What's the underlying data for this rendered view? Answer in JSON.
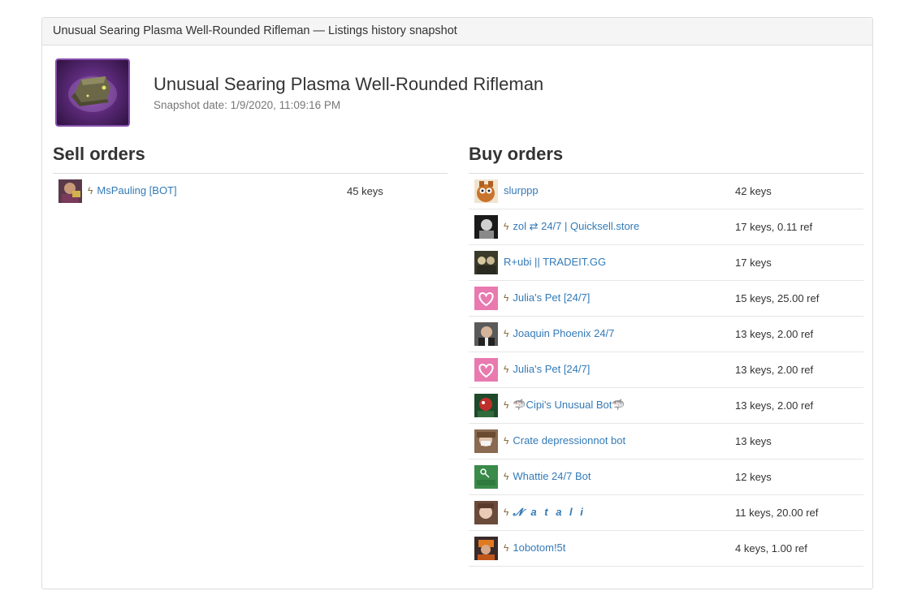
{
  "panel": {
    "heading": "Unusual Searing Plasma Well-Rounded Rifleman — Listings history snapshot"
  },
  "item": {
    "name": "Unusual Searing Plasma Well-Rounded Rifleman",
    "snapshot_date": "Snapshot date: 1/9/2020, 11:09:16 PM",
    "icon": "item-hat-icon",
    "quality_color": "#8650AC"
  },
  "sell": {
    "title": "Sell orders",
    "orders": [
      {
        "name": "MsPauling [BOT]",
        "price": "45 keys",
        "bot": true,
        "avatar": "avatar-icon"
      }
    ]
  },
  "buy": {
    "title": "Buy orders",
    "orders": [
      {
        "name": "slurppp",
        "price": "42 keys",
        "bot": false
      },
      {
        "name": "zol ⇄ 24/7 | Quicksell.store",
        "price": "17 keys, 0.11 ref",
        "bot": true
      },
      {
        "name": "R+ubi || TRADEIT.GG",
        "price": "17 keys",
        "bot": false
      },
      {
        "name": "Julia's Pet [24/7]",
        "price": "15 keys, 25.00 ref",
        "bot": true
      },
      {
        "name": "Joaquin Phoenix 24/7",
        "price": "13 keys, 2.00 ref",
        "bot": true
      },
      {
        "name": "Julia's Pet [24/7]",
        "price": "13 keys, 2.00 ref",
        "bot": true
      },
      {
        "name": "🦈Cipi's Unusual Bot🦈",
        "price": "13 keys, 2.00 ref",
        "bot": true
      },
      {
        "name": "Crate depressionnot bot",
        "price": "13 keys",
        "bot": true
      },
      {
        "name": "Whattie 24/7 Bot",
        "price": "12 keys",
        "bot": true
      },
      {
        "name": "𝓝 a t a l i",
        "price": "11 keys, 20.00 ref",
        "bot": true
      },
      {
        "name": "1obotom!5t",
        "price": "4 keys, 1.00 ref",
        "bot": true
      }
    ]
  },
  "icons": {
    "bot": "lightning-bolt-icon",
    "bot_glyph": "ϟ"
  },
  "colors": {
    "link": "#337ab7",
    "bolt": "#8a6d3b"
  }
}
